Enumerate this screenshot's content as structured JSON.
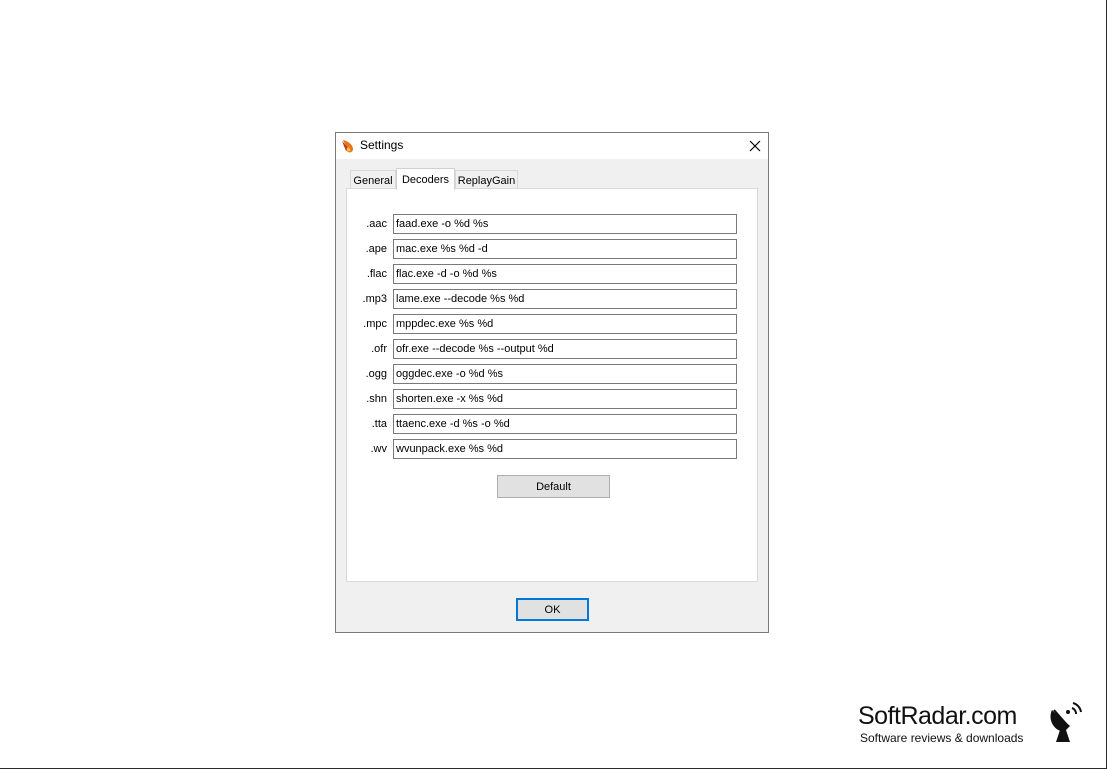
{
  "dialog": {
    "title": "Settings",
    "tabs": [
      {
        "label": "General",
        "active": false
      },
      {
        "label": "Decoders",
        "active": true
      },
      {
        "label": "ReplayGain",
        "active": false
      }
    ],
    "decoders": [
      {
        "ext": ".aac",
        "command": "faad.exe -o %d %s"
      },
      {
        "ext": ".ape",
        "command": "mac.exe %s %d -d"
      },
      {
        "ext": ".flac",
        "command": "flac.exe -d -o %d %s"
      },
      {
        "ext": ".mp3",
        "command": "lame.exe --decode %s %d"
      },
      {
        "ext": ".mpc",
        "command": "mppdec.exe %s %d"
      },
      {
        "ext": ".ofr",
        "command": "ofr.exe --decode %s --output %d"
      },
      {
        "ext": ".ogg",
        "command": "oggdec.exe -o %d %s"
      },
      {
        "ext": ".shn",
        "command": "shorten.exe -x %s %d"
      },
      {
        "ext": ".tta",
        "command": "ttaenc.exe -d %s -o %d"
      },
      {
        "ext": ".wv",
        "command": "wvunpack.exe %s %d"
      }
    ],
    "default_label": "Default",
    "ok_label": "OK",
    "icons": {
      "app": "flame-app-icon",
      "close": "close-icon"
    },
    "colors": {
      "accent": "#0078d7"
    }
  },
  "watermark": {
    "name": "SoftRadar.com",
    "tagline": "Software reviews & downloads",
    "icon": "satellite-dish-icon"
  }
}
